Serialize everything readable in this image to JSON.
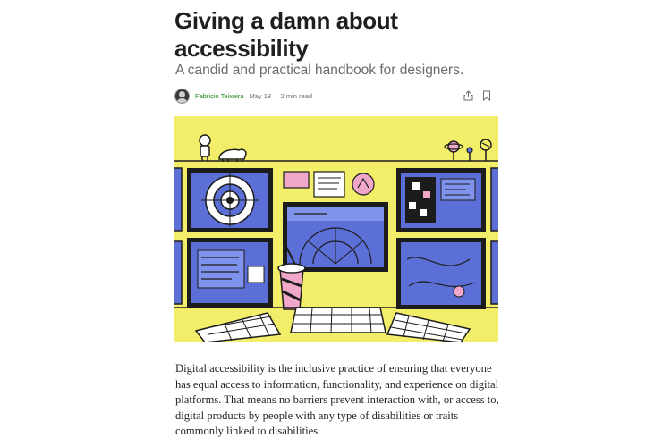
{
  "article": {
    "title": "Giving a damn about accessibility",
    "subtitle": "A candid and practical handbook for designers.",
    "author": "Fabricio Teixeira",
    "date": "May 18",
    "separator": "·",
    "read_time": "2 min read",
    "body": "Digital accessibility is the inclusive practice of ensuring that everyone has equal access to information, functionality, and experience on digital platforms. That means no barriers prevent interaction with, or access to, digital products by people with any type of disabilities or traits commonly linked to disabilities."
  },
  "icons": {
    "share": "share-icon",
    "bookmark": "bookmark-icon",
    "avatar": "author-avatar"
  },
  "colors": {
    "hero_background": "#f3ee6a",
    "screen_blue": "#5b6fd6",
    "author_link": "#1a8917",
    "outline": "#1c1c1c"
  }
}
